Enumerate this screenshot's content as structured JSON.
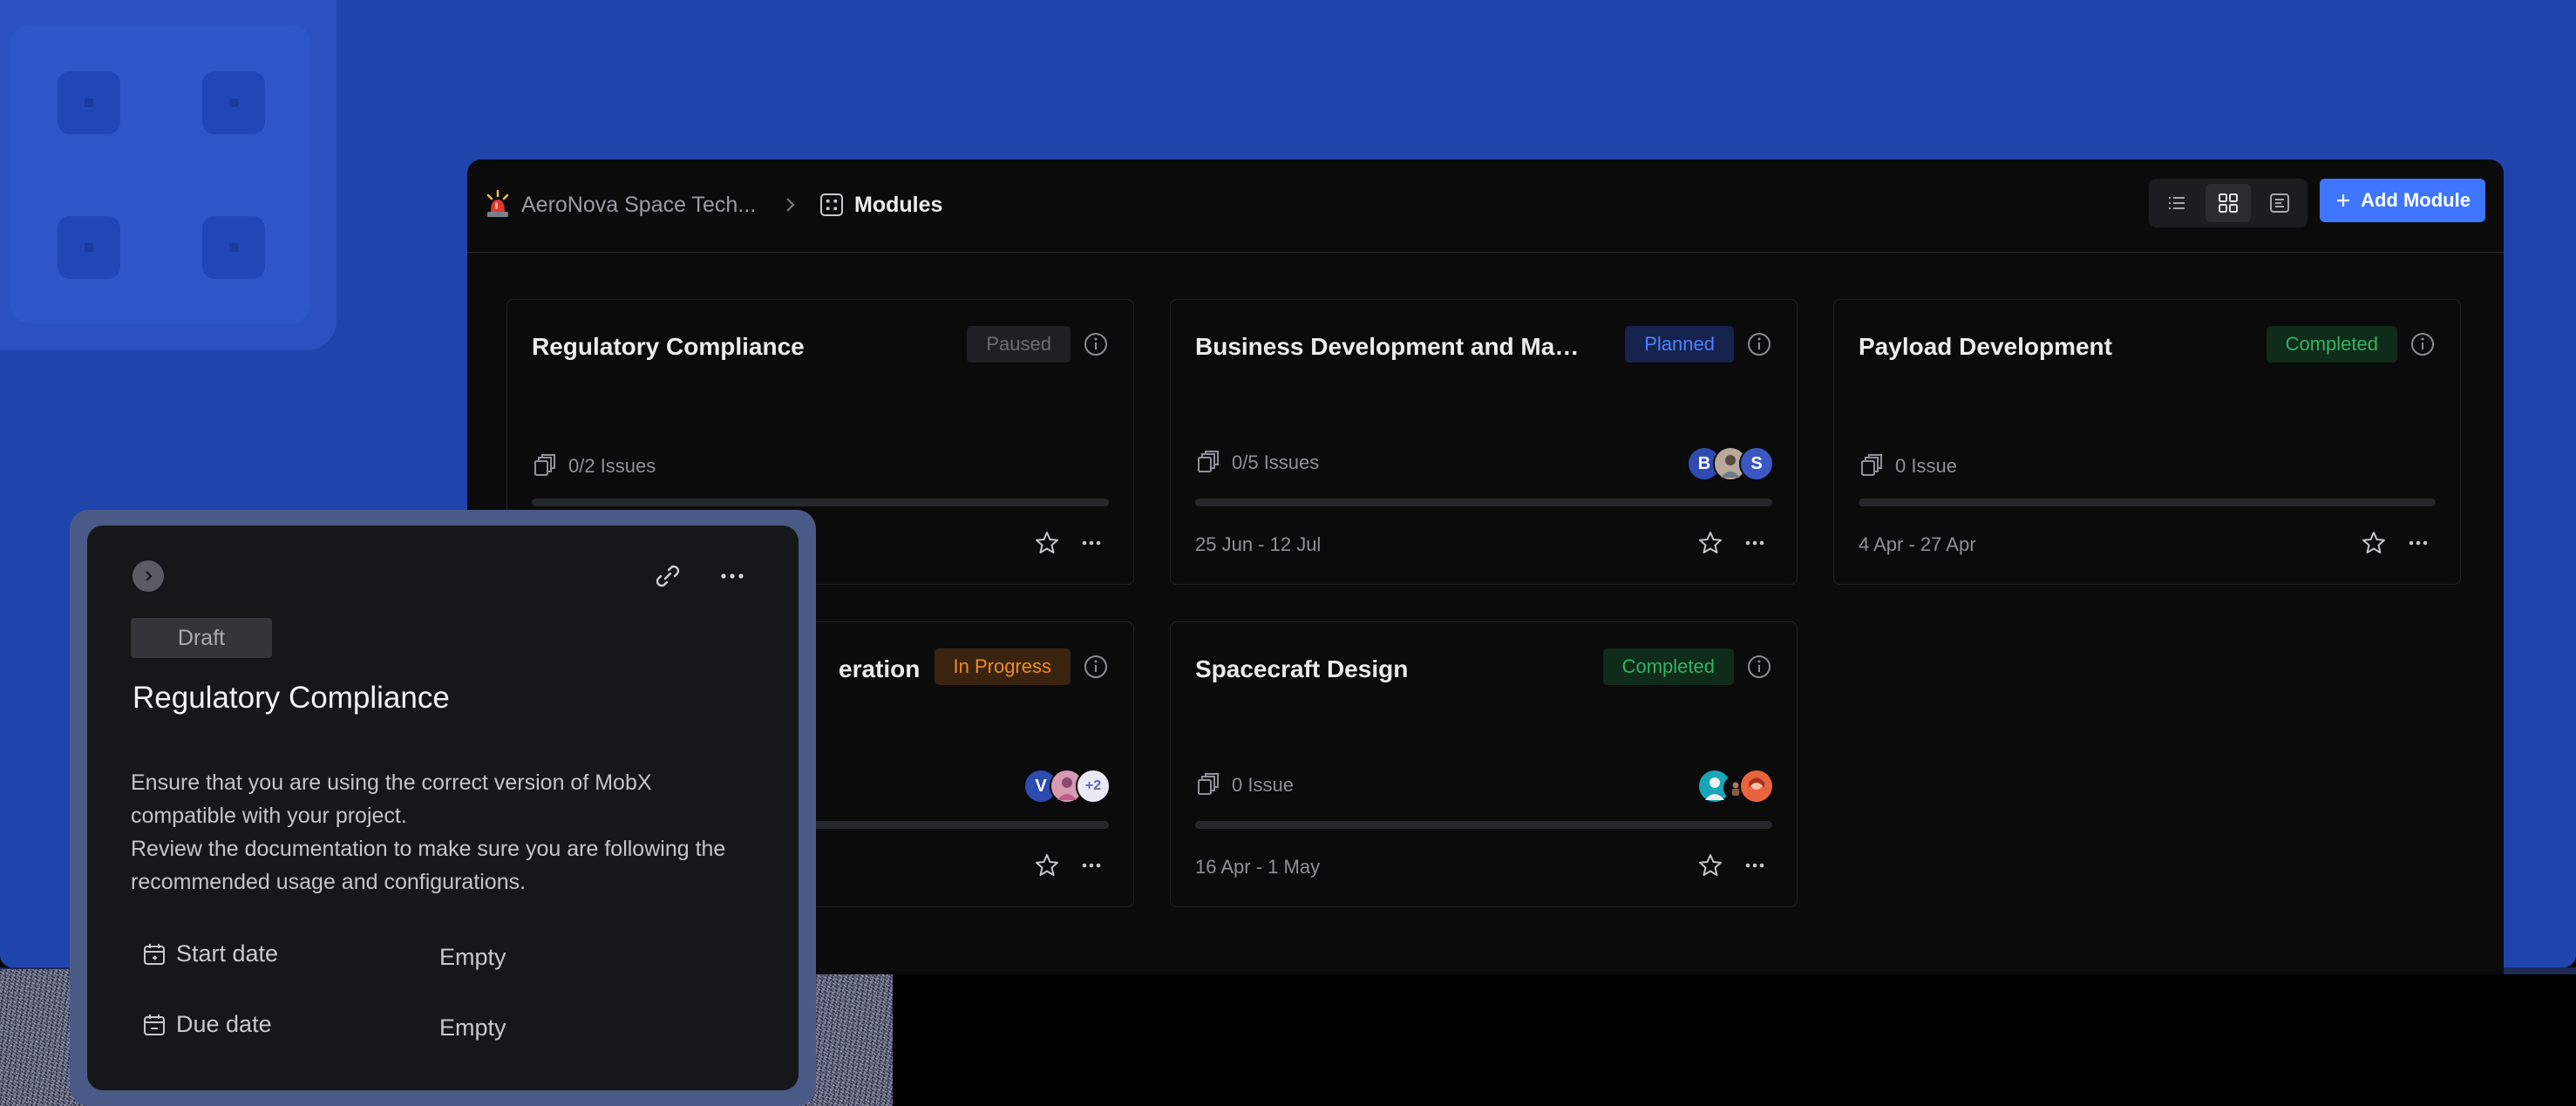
{
  "breadcrumb": {
    "project": "AeroNova Space Tech...",
    "current": "Modules"
  },
  "header": {
    "add_button_label": "Add Module",
    "layouts": [
      "list",
      "gallery",
      "timeline"
    ],
    "active_layout": "gallery"
  },
  "modules": [
    {
      "title": "Regulatory Compliance",
      "status": "Paused",
      "issues": "0/2 Issues",
      "progress": 0,
      "date": ""
    },
    {
      "title": "Business Development and Mark...",
      "status": "Planned",
      "issues": "0/5 Issues",
      "progress": 0,
      "date": "25 Jun - 12 Jul",
      "avatars": [
        "B",
        "",
        "S"
      ]
    },
    {
      "title": "Payload Development",
      "status": "Completed",
      "issues": "0 Issue",
      "progress": 0,
      "date": "4 Apr - 27 Apr"
    },
    {
      "title": "eration",
      "status": "In Progress",
      "progress": 0,
      "avatars": [
        "V",
        "",
        "+2"
      ]
    },
    {
      "title": "Spacecraft Design",
      "status": "Completed",
      "issues": "0 Issue",
      "progress": 0,
      "date": "16 Apr - 1 May"
    }
  ],
  "status_colors": {
    "Paused": {
      "bg": "#1f2023",
      "fg": "#6b6d73"
    },
    "Planned": {
      "bg": "#15234d",
      "fg": "#4f80ff"
    },
    "Completed": {
      "bg": "#0f2b1a",
      "fg": "#2fb562"
    },
    "In Progress": {
      "bg": "#3a2410",
      "fg": "#f08a24"
    }
  },
  "peek": {
    "status": "Draft",
    "title": "Regulatory Compliance",
    "description": [
      "Ensure that you are using the correct version of MobX",
      "compatible with your project.",
      "Review the documentation to make sure you are following the",
      "recommended usage and configurations."
    ],
    "start_label": "Start date",
    "start_value": "Empty",
    "due_label": "Due date",
    "due_value": "Empty"
  },
  "colors": {
    "accent": "#3f76ff",
    "background": "#1f44ac"
  }
}
